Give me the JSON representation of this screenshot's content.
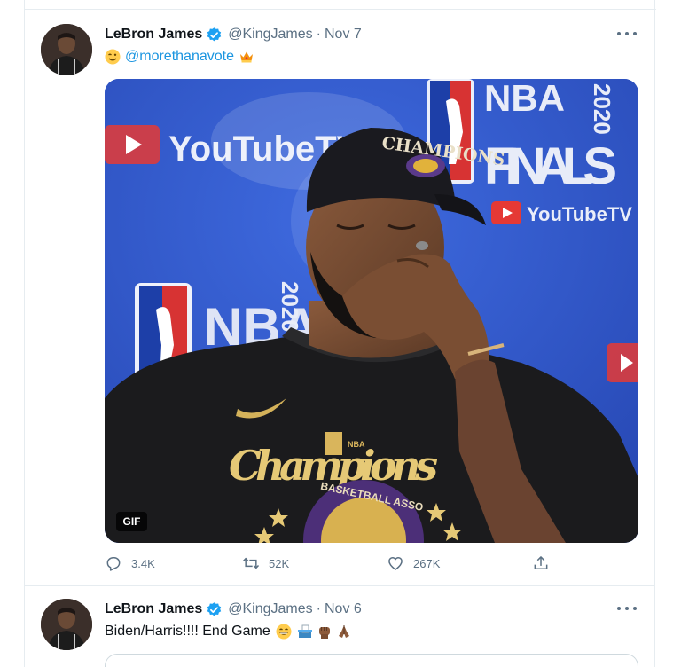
{
  "tweets": [
    {
      "author": "LeBron James",
      "handle": "@KingJames",
      "separator": "·",
      "date": "Nov 7",
      "mention": "@morethanavote",
      "emoji_before": "winking-face-emoji",
      "emoji_after": "crown-emoji",
      "media": {
        "badge": "GIF",
        "sign_left_brand": "YouTubeTV",
        "sign_right_brand": "YouTubeTV",
        "finals_line1": "NBA",
        "finals_line2": "FINALS",
        "finals_year": "2020",
        "lower_logo": "NBA",
        "lower_year": "2020",
        "cap_text": "CHAMPIONS",
        "shirt_text": "Champions",
        "shirt_arc": "BASKETBALL ASSO"
      },
      "actions": {
        "replies": "3.4K",
        "retweets": "52K",
        "likes": "267K"
      }
    },
    {
      "author": "LeBron James",
      "handle": "@KingJames",
      "separator": "·",
      "date": "Nov 6",
      "text": "Biden/Harris!!!! End Game",
      "emojis": [
        "grinning-face-emoji",
        "ballot-box-emoji",
        "raised-fist-emoji",
        "folded-hands-emoji"
      ]
    }
  ],
  "colors": {
    "link": "#1b95e0",
    "verified": "#1da1f2",
    "secondary_text": "#5b7083",
    "media_background": "#2f58c8"
  }
}
